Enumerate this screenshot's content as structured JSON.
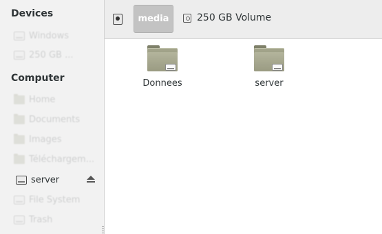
{
  "sidebar": {
    "devices_title": "Devices",
    "computer_title": "Computer",
    "devices": [
      {
        "label": "Windows",
        "icon": "drive-icon"
      },
      {
        "label": "250 GB ...",
        "icon": "drive-icon"
      }
    ],
    "places": [
      {
        "label": "Home",
        "icon": "folder-icon"
      },
      {
        "label": "Documents",
        "icon": "folder-icon"
      },
      {
        "label": "Images",
        "icon": "folder-icon"
      },
      {
        "label": "Téléchargem...",
        "icon": "folder-icon"
      },
      {
        "label": "server",
        "icon": "drive-icon"
      },
      {
        "label": "File System",
        "icon": "drive-icon"
      },
      {
        "label": "Trash",
        "icon": "trash-icon"
      }
    ]
  },
  "pathbar": {
    "current": "media",
    "volume": "250 GB Volume"
  },
  "files": [
    {
      "name": "Donnees",
      "icon": "folder-drive-icon"
    },
    {
      "name": "server",
      "icon": "folder-drive-icon"
    }
  ],
  "colors": {
    "sidebar_bg": "#f2f2f2",
    "pathbar_bg": "#ededed",
    "active_crumb": "#c3c3c3",
    "folder": "#9a9b82"
  }
}
